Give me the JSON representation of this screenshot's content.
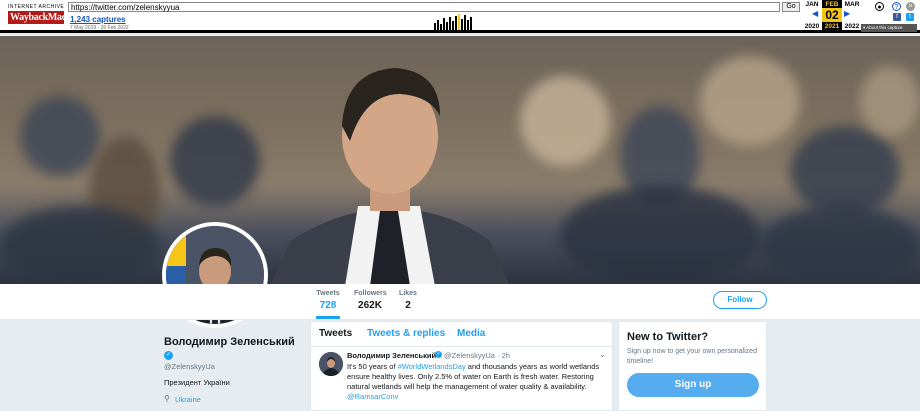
{
  "wayback": {
    "logo_top": "INTERNET ARCHIVE",
    "logo_main": "WaybackMachine",
    "url": "https://twitter.com/zelenskyyua",
    "go_label": "Go",
    "captures": "1,243 captures",
    "range": "7 May 2019 - 26 Feb 2022",
    "prev_month": "JAN",
    "prev_year": "2020",
    "cur_month": "FEB",
    "cur_day": "02",
    "cur_year": "2021",
    "next_month": "MAR",
    "next_year": "2022",
    "about": "▾ About this capture",
    "icons": [
      "user-icon",
      "help-icon",
      "close-icon",
      "facebook-icon",
      "twitter-icon"
    ]
  },
  "profile": {
    "name": "Володимир Зеленський",
    "handle": "@ZelenskyyUa",
    "bio": "Президент України",
    "location": "Ukraine"
  },
  "stats": [
    {
      "label": "Tweets",
      "value": "728"
    },
    {
      "label": "Followers",
      "value": "262K"
    },
    {
      "label": "Likes",
      "value": "2"
    }
  ],
  "follow_label": "Follow",
  "timeline": {
    "tabs": [
      "Tweets",
      "Tweets & replies",
      "Media"
    ],
    "tweet": {
      "name": "Володимир Зеленський",
      "meta": "@ZelenskyyUa · 2h",
      "text_a": "It's 50 years of ",
      "link_a": "#WorldWetlandsDay",
      "text_b": " and thousands years as world wetlands ensure healthy lives. Only 2.5% of water on Earth is fresh water. Restoring natural wetlands will help the management of water quality & availability.",
      "link_b": "@RamsarConv"
    }
  },
  "new_to_twitter": {
    "title": "New to Twitter?",
    "text": "Sign up now to get your own personalized timeline!",
    "button": "Sign up"
  },
  "colors": {
    "accent": "#1da1f2",
    "background": "#e6ecf0",
    "wayback_red": "#b31b1b",
    "wayback_yellow": "#f5c518"
  }
}
